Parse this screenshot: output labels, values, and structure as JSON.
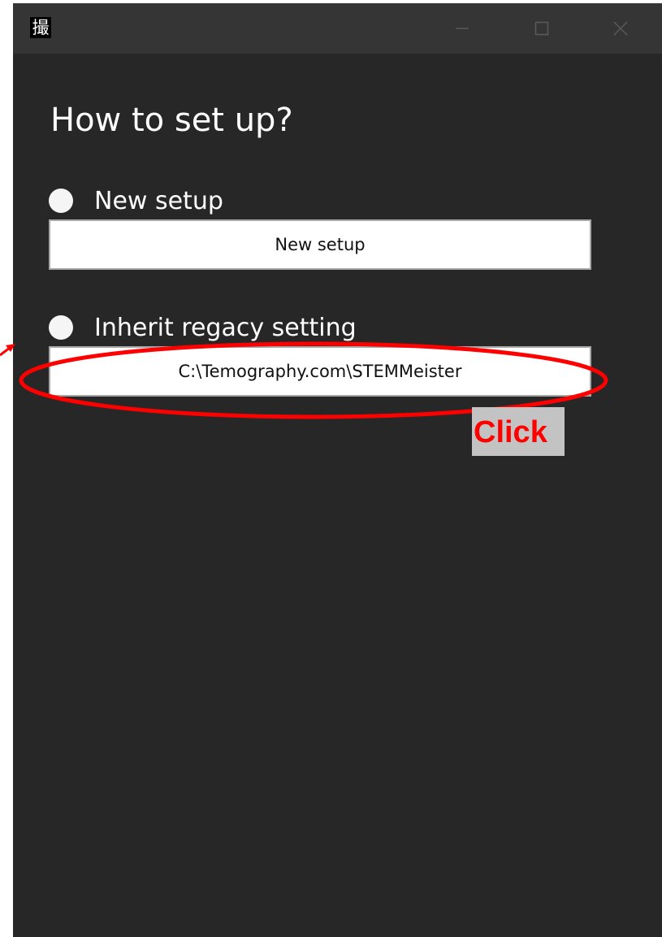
{
  "window": {
    "app_icon_glyph": "撮",
    "icons": {
      "minimize": "minimize-icon",
      "maximize": "maximize-icon",
      "close": "close-icon"
    }
  },
  "main": {
    "title": "How to set up?",
    "options": [
      {
        "label": "New setup",
        "button_text": "New setup"
      },
      {
        "label": "Inherit regacy setting",
        "button_text": "C:\\Temography.com\\STEMMeister"
      }
    ]
  },
  "annotation": {
    "callout_text": "Click",
    "color": "#ff0000",
    "label_background": "#c3c3c3"
  },
  "colors": {
    "window_background": "#272727",
    "titlebar_background": "#353535",
    "text": "#ffffff"
  }
}
